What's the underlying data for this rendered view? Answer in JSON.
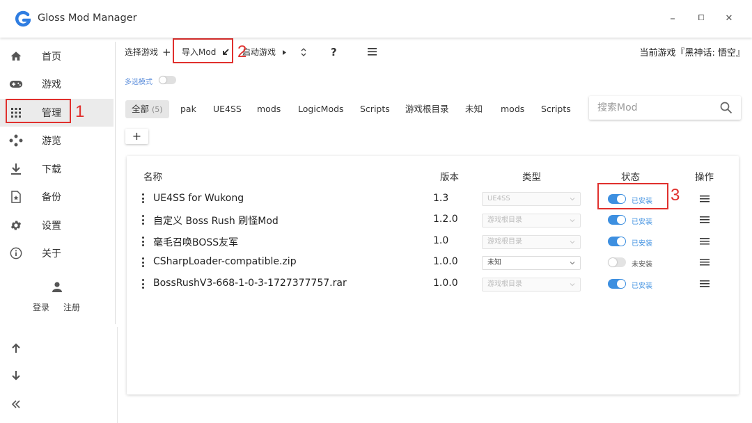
{
  "app": {
    "title": "Gloss Mod Manager",
    "brand_color": "#2f7de1"
  },
  "window_controls": {
    "minimize": "–",
    "maximize": "⧠",
    "close": "✕"
  },
  "sidebar": {
    "items": [
      {
        "label": "首页",
        "icon": "home-icon"
      },
      {
        "label": "游戏",
        "icon": "gamepad-icon"
      },
      {
        "label": "管理",
        "icon": "grid-icon",
        "active": true
      },
      {
        "label": "游览",
        "icon": "dots-icon"
      },
      {
        "label": "下载",
        "icon": "download-icon"
      },
      {
        "label": "备份",
        "icon": "backup-icon"
      },
      {
        "label": "设置",
        "icon": "gear-icon"
      },
      {
        "label": "关于",
        "icon": "info-icon"
      }
    ],
    "login": "登录",
    "register": "注册"
  },
  "toolbar": {
    "select_game": "选择游戏",
    "select_game_plus": "+",
    "import_mod": "导入Mod",
    "launch_game": "启动游戏",
    "help": "?",
    "current_game": "当前游戏『黑神话: 悟空』"
  },
  "multi_select": {
    "label": "多选模式",
    "enabled": false
  },
  "type_tabs": [
    {
      "label": "全部",
      "count": "(5)",
      "active": true
    },
    {
      "label": "pak"
    },
    {
      "label": "UE4SS"
    },
    {
      "label": "mods"
    },
    {
      "label": "LogicMods"
    },
    {
      "label": "Scripts"
    },
    {
      "label": "游戏根目录"
    },
    {
      "label": "未知"
    },
    {
      "label": "mods"
    },
    {
      "label": "Scripts"
    }
  ],
  "search": {
    "placeholder": "搜索Mod"
  },
  "add_button": "+",
  "table": {
    "headers": {
      "name": "名称",
      "version": "版本",
      "type": "类型",
      "status": "状态",
      "actions": "操作"
    },
    "rows": [
      {
        "name": "UE4SS for Wukong",
        "version": "1.3",
        "type": "UE4SS",
        "installed": true,
        "status": "已安装"
      },
      {
        "name": "自定义 Boss Rush 刷怪Mod",
        "version": "1.2.0",
        "type": "游戏根目录",
        "installed": true,
        "status": "已安装"
      },
      {
        "name": "毫毛召唤BOSS友军",
        "version": "1.0",
        "type": "游戏根目录",
        "installed": true,
        "status": "已安装"
      },
      {
        "name": "CSharpLoader-compatible.zip",
        "version": "1.0.0",
        "type": "未知",
        "installed": false,
        "status": "未安装"
      },
      {
        "name": "BossRushV3-668-1-0-3-1727377757.rar",
        "version": "1.0.0",
        "type": "游戏根目录",
        "installed": true,
        "status": "已安装"
      }
    ]
  },
  "annotations": {
    "one": "1",
    "two": "2",
    "three": "3",
    "color": "#e0302d"
  }
}
